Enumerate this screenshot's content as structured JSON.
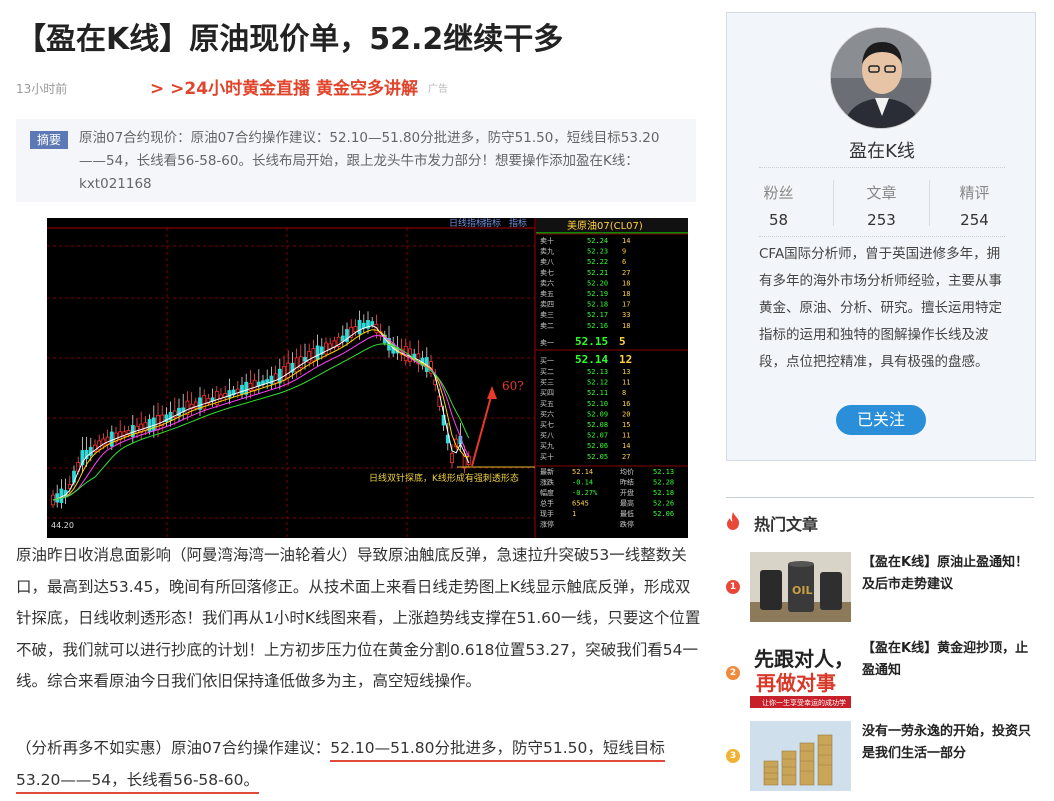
{
  "article": {
    "title": "【盈在K线】原油现价单，52.2继续干多",
    "time": "13小时前",
    "ad_link": "> >24小时黄金直播 黄金空多讲解",
    "ad_tag": "广告",
    "summary_badge": "摘要",
    "summary": "原油07合约现价：原油07合约操作建议：52.10—51.80分批进多，防守51.50，短线目标53.20——54，长线看56-58-60。长线布局开始，跟上龙头牛市发力部分！想要操作添加盈在K线：kxt021168",
    "body": "原油昨日收消息面影响（阿曼湾海湾一油轮着火）导致原油触底反弹，急速拉升突破53一线整数关口，最高到达53.45，晚间有所回落修正。从技术面上来看日线走势图上K线显示触底反弹，形成双针探底，日线收刺透形态！我们再从1小时K线图来看，上涨趋势线支撑在51.60一线，只要这个位置不破，我们就可以进行抄底的计划！上方初步压力位在黄金分割0.618位置53.27，突破我们看54一线。综合来看原油今日我们依旧保持逢低做多为主，高空短线操作。",
    "advice_prefix": "（分析再多不如实惠）原油07合约操作建议：",
    "advice_line1": "52.10—51.80分批进多，防守51.50，短线目标",
    "advice_line2": "53.20——54，长线看56-58-60。"
  },
  "chart_image": {
    "header_links": [
      "日线指标",
      "指标",
      "指标",
      "指标"
    ],
    "ticker": "美原油07(CL07)",
    "low_label": "44.20",
    "annotation_target": "60?",
    "annotation_text": "日线双针探底，K线形成有强刺透形态",
    "sell_rows": [
      {
        "l": "卖十",
        "p": "52.24",
        "v": "14"
      },
      {
        "l": "卖九",
        "p": "52.23",
        "v": "9"
      },
      {
        "l": "卖八",
        "p": "52.22",
        "v": "6"
      },
      {
        "l": "卖七",
        "p": "52.21",
        "v": "27"
      },
      {
        "l": "卖六",
        "p": "52.20",
        "v": "18"
      },
      {
        "l": "卖五",
        "p": "52.19",
        "v": "18"
      },
      {
        "l": "卖四",
        "p": "52.18",
        "v": "17"
      },
      {
        "l": "卖三",
        "p": "52.17",
        "v": "33"
      },
      {
        "l": "卖二",
        "p": "52.16",
        "v": "18"
      },
      {
        "l": "卖一",
        "p": "52.15",
        "v": "5"
      }
    ],
    "buy_rows": [
      {
        "l": "买一",
        "p": "52.14",
        "v": "12"
      },
      {
        "l": "买二",
        "p": "52.13",
        "v": "13"
      },
      {
        "l": "买三",
        "p": "52.12",
        "v": "11"
      },
      {
        "l": "买四",
        "p": "52.11",
        "v": "8"
      },
      {
        "l": "买五",
        "p": "52.10",
        "v": "16"
      },
      {
        "l": "买六",
        "p": "52.09",
        "v": "20"
      },
      {
        "l": "买七",
        "p": "52.08",
        "v": "15"
      },
      {
        "l": "买八",
        "p": "52.07",
        "v": "11"
      },
      {
        "l": "买九",
        "p": "52.06",
        "v": "14"
      },
      {
        "l": "买十",
        "p": "52.05",
        "v": "27"
      }
    ],
    "quote_rows": [
      {
        "a": "最新",
        "b": "52.14",
        "c": "均价",
        "d": "52.13"
      },
      {
        "a": "涨跌",
        "b": "-0.14",
        "c": "昨结",
        "d": "52.28"
      },
      {
        "a": "幅度",
        "b": "-0.27%",
        "c": "开盘",
        "d": "52.18"
      },
      {
        "a": "总手",
        "b": "6545",
        "c": "最高",
        "d": "52.26"
      },
      {
        "a": "现手",
        "b": "1",
        "c": "最低",
        "d": "52.06"
      },
      {
        "a": "涨停",
        "b": "",
        "c": "跌停",
        "d": ""
      }
    ]
  },
  "sidebar": {
    "author_name": "盈在K线",
    "stats": [
      {
        "label": "粉丝",
        "value": "58"
      },
      {
        "label": "文章",
        "value": "253"
      },
      {
        "label": "精评",
        "value": "254"
      }
    ],
    "bio": "CFA国际分析师，曾于英国进修多年，拥有多年的海外市场分析师经验，主要从事黄金、原油、分析、研究。擅长运用特定指标的运用和独特的图解操作长线及波段，点位把控精准，具有极强的盘感。",
    "follow_label": "已关注"
  },
  "hot": {
    "title": "热门文章",
    "items": [
      {
        "rank": "1",
        "title": "【盈在K线】原油止盈通知！及后市走势建议",
        "color": "#e8483a"
      },
      {
        "rank": "2",
        "title": "【盈在K线】黄金迎抄顶，止盈通知",
        "color": "#f08a3c"
      },
      {
        "rank": "3",
        "title": "没有一劳永逸的开始，投资只是我们生活一部分",
        "color": "#f2b233"
      }
    ],
    "thumb2_line1": "先跟对人，",
    "thumb2_line2": "再做对事",
    "thumb2_caption": "让你一生享受幸运的成功学",
    "thumb1_text": "OIL"
  },
  "colors": {
    "accent_red": "#e0442b",
    "badge_blue": "#5c79b6",
    "follow_blue": "#2a8fd8"
  }
}
